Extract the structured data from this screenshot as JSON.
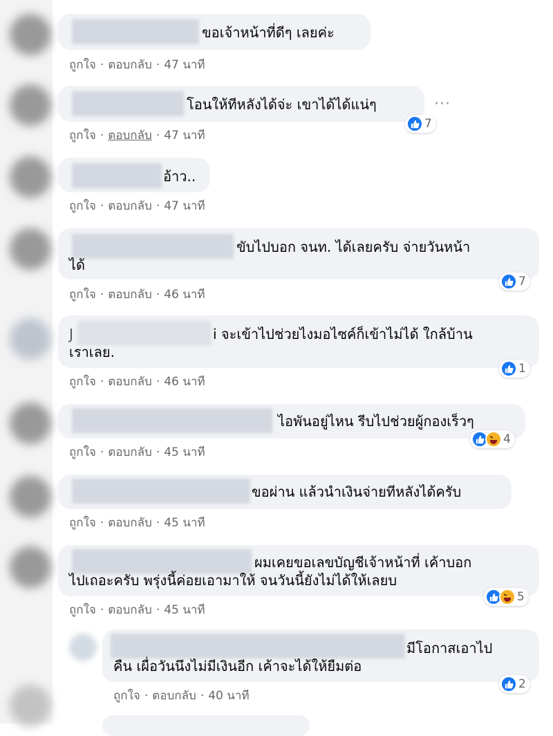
{
  "comments": [
    {
      "text1": "ขอเจ้าหน้าที่ดีๆ เลยค่ะ",
      "like": "ถูกใจ",
      "reply": "ตอบกลับ",
      "time": "47 นาที"
    },
    {
      "text1": "โอนให้ทีหลังได้จ่ะ เขาได้ได้แน่ๆ",
      "like": "ถูกใจ",
      "reply": "ตอบกลับ",
      "time": "47 นาที",
      "reactions": "7",
      "reaction_icons": [
        "like-icon"
      ],
      "more": "···"
    },
    {
      "text1": "อ้าว..",
      "like": "ถูกใจ",
      "reply": "ตอบกลับ",
      "time": "47 นาที"
    },
    {
      "text1": "ขับไปบอก จนท. ได้เลยครับ จ่ายวันหน้า",
      "text2": "ได้",
      "like": "ถูกใจ",
      "reply": "ตอบกลับ",
      "time": "46 นาที",
      "reactions": "7",
      "reaction_icons": [
        "like-icon"
      ]
    },
    {
      "name_fragment": "J",
      "text1": "i จะเข้าไปช่วยไงมอไซค์ก็เข้าไม่ได้ ใกล้บ้าน",
      "text2": "เราเลย.",
      "like": "ถูกใจ",
      "reply": "ตอบกลับ",
      "time": "46 นาที",
      "reactions": "1",
      "reaction_icons": [
        "like-icon"
      ]
    },
    {
      "text1": "ไอพันอยู่ไหน รีบไปช่วยผู้กองเร็วๆ",
      "like": "ถูกใจ",
      "reply": "ตอบกลับ",
      "time": "45 นาที",
      "reactions": "4",
      "reaction_icons": [
        "like-icon",
        "haha-icon"
      ]
    },
    {
      "text1": "ขอผ่าน แล้วนำเงินจ่ายทีหลังได้ครับ",
      "like": "ถูกใจ",
      "reply": "ตอบกลับ",
      "time": "45 นาที"
    },
    {
      "text1": "ผมเคยขอเลขบัญชีเจ้าหน้าที่ เค้าบอก",
      "text2": "ไปเถอะครับ พรุ่งนี้ค่อยเอามาให้ จนวันนี้ยังไม่ได้ให้เลยบ",
      "like": "ถูกใจ",
      "reply": "ตอบกลับ",
      "time": "45 นาที",
      "reactions": "5",
      "reaction_icons": [
        "like-icon",
        "haha-icon"
      ]
    }
  ],
  "reply": {
    "text1": "มีโอกาสเอาไป",
    "text2": "คืน เผื่อวันนึงไม่มีเงินอีก เค้าจะได้ให้ยืมต่อ",
    "like": "ถูกใจ",
    "reply": "ตอบกลับ",
    "time": "40 นาที",
    "reactions": "2",
    "reaction_icons": [
      "like-icon"
    ]
  },
  "separator": "·",
  "colors": {
    "bubble": "#f0f2f5",
    "like_blue": "#1877f2",
    "meta_gray": "#65676b"
  }
}
